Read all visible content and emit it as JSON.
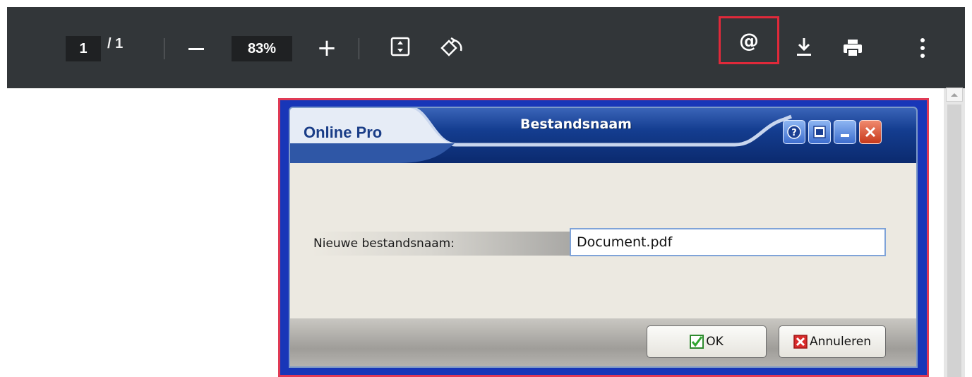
{
  "toolbar": {
    "page_current": "1",
    "page_separator": "/ 1",
    "zoom": "83%",
    "zoom_in": "+",
    "email_icon": "@",
    "icons": [
      "minus-icon",
      "plus-icon",
      "fit-page-icon",
      "rotate-icon",
      "email-icon",
      "download-icon",
      "print-icon",
      "more-icon"
    ],
    "highlight_color": "#e0293a"
  },
  "dialog": {
    "brand": "Online Pro",
    "title": "Bestandsnaam",
    "field_label": "Nieuwe bestandsnaam:",
    "field_value": "Document.pdf",
    "ok_label": "OK",
    "cancel_label": "Annuleren",
    "title_bar_color": "#0b2a6e",
    "outline_color": "#e03a55"
  }
}
